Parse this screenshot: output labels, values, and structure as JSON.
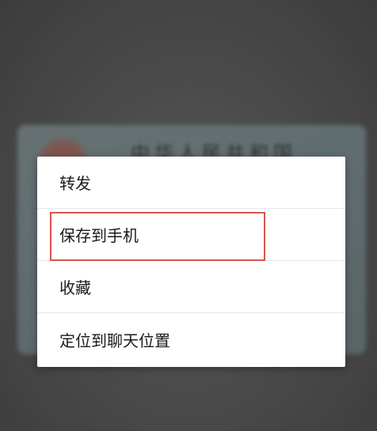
{
  "background": {
    "card_title": "中华人民共和国"
  },
  "menu": {
    "items": [
      {
        "label": "转发"
      },
      {
        "label": "保存到手机"
      },
      {
        "label": "收藏"
      },
      {
        "label": "定位到聊天位置"
      }
    ]
  },
  "colors": {
    "highlight": "#d9534f",
    "menu_background": "#ffffff"
  }
}
